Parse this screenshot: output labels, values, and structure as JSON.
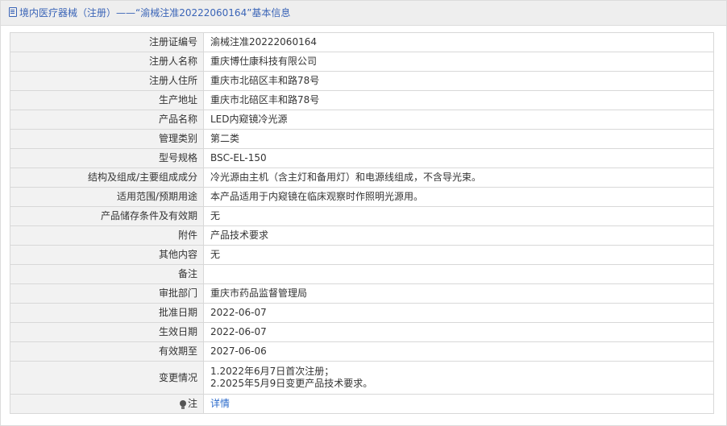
{
  "header": {
    "title": "境内医疗器械（注册）——“渝械注准20222060164”基本信息"
  },
  "rows": [
    {
      "label": "注册证编号",
      "value": "渝械注准20222060164"
    },
    {
      "label": "注册人名称",
      "value": "重庆博仕康科技有限公司"
    },
    {
      "label": "注册人住所",
      "value": "重庆市北碚区丰和路78号"
    },
    {
      "label": "生产地址",
      "value": "重庆市北碚区丰和路78号"
    },
    {
      "label": "产品名称",
      "value": "LED内窥镜冷光源"
    },
    {
      "label": "管理类别",
      "value": "第二类"
    },
    {
      "label": "型号规格",
      "value": "BSC-EL-150"
    },
    {
      "label": "结构及组成/主要组成成分",
      "value": "冷光源由主机（含主灯和备用灯）和电源线组成，不含导光束。"
    },
    {
      "label": "适用范围/预期用途",
      "value": "本产品适用于内窥镜在临床观察时作照明光源用。"
    },
    {
      "label": "产品储存条件及有效期",
      "value": "无"
    },
    {
      "label": "附件",
      "value": "产品技术要求"
    },
    {
      "label": "其他内容",
      "value": "无"
    },
    {
      "label": "备注",
      "value": ""
    },
    {
      "label": "审批部门",
      "value": "重庆市药品监督管理局"
    },
    {
      "label": "批准日期",
      "value": "2022-06-07"
    },
    {
      "label": "生效日期",
      "value": "2022-06-07"
    },
    {
      "label": "有效期至",
      "value": "2027-06-06"
    }
  ],
  "changes": {
    "label": "变更情况",
    "lines": [
      "1.2022年6月7日首次注册；",
      "2.2025年5月9日变更产品技术要求。"
    ]
  },
  "note": {
    "label": "注",
    "icon": "lightbulb-icon",
    "link": "详情"
  }
}
